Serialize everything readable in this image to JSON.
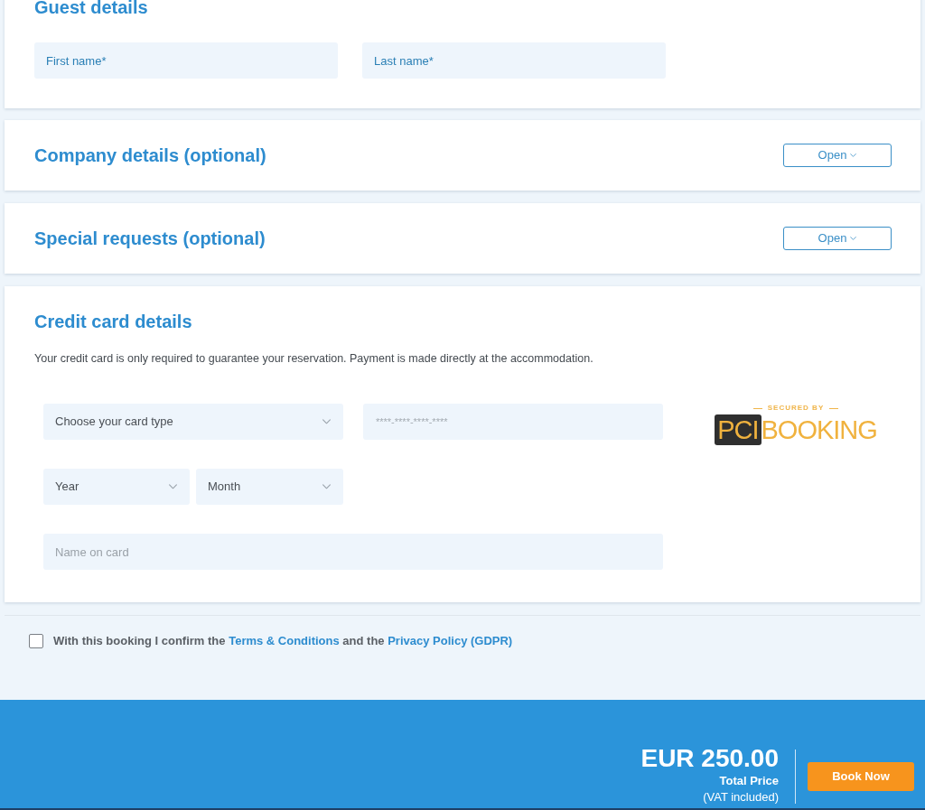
{
  "guest_details": {
    "title": "Guest details",
    "fields": [
      {
        "placeholder": "First name*"
      },
      {
        "placeholder": "Last name*"
      }
    ]
  },
  "optional_sections": [
    {
      "title": "Company details (optional)",
      "button": "Open"
    },
    {
      "title": "Special requests (optional)",
      "button": "Open"
    }
  ],
  "credit_card": {
    "title": "Credit card details",
    "note": "Your credit card is only required to guarantee your reservation. Payment is made directly at the accommodation.",
    "card_type": {
      "value": "Choose your card type"
    },
    "card_number": {
      "placeholder": "****-****-****-****"
    },
    "expiry": [
      {
        "value": "Year"
      },
      {
        "value": "Month"
      }
    ],
    "name_on_card": {
      "placeholder": "Name on card"
    },
    "security_badge": {
      "caption": "SECURED BY",
      "mark": "PCI",
      "wordmark": "BOOKING"
    }
  },
  "consent": {
    "checked": false,
    "parts": [
      {
        "kind": "text",
        "text": "With this booking I confirm the"
      },
      {
        "kind": "link",
        "text": "Terms & Conditions"
      },
      {
        "kind": "text",
        "text": "and the"
      },
      {
        "kind": "link",
        "text": "Privacy Policy (GDPR)"
      }
    ]
  },
  "footer": {
    "price": "EUR 250.00",
    "price_label": "Total Price",
    "price_note": "(VAT included)",
    "button": "Book Now"
  }
}
